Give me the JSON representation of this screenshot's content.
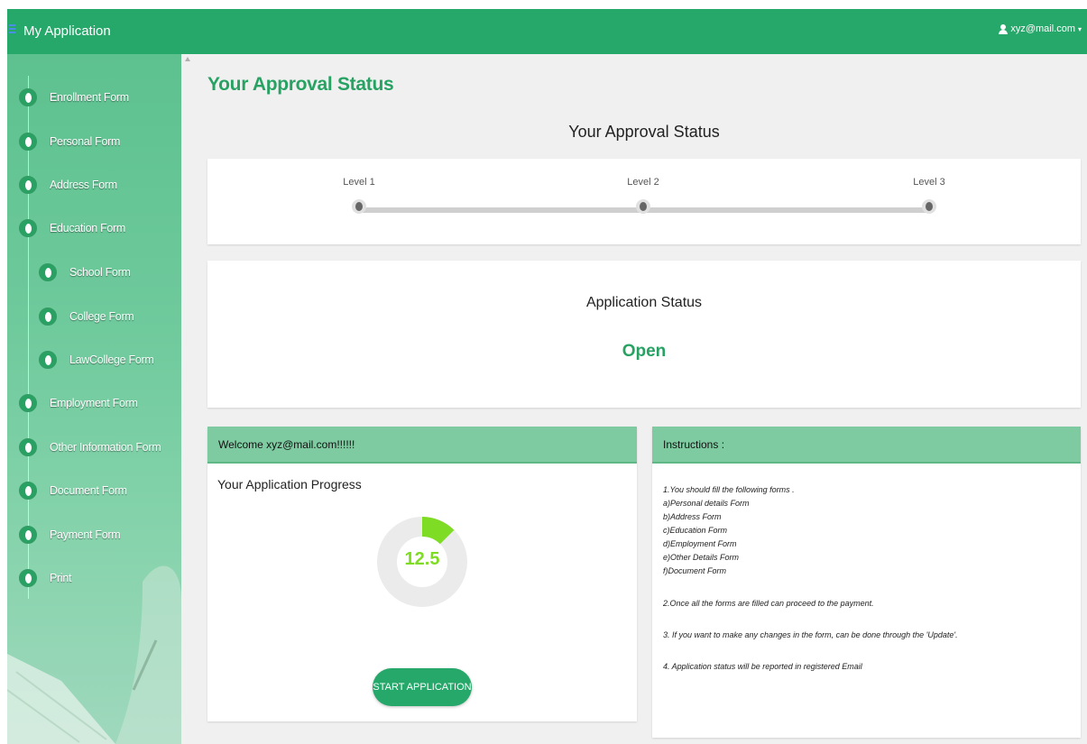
{
  "header": {
    "app_title": "My Application",
    "user_email": "xyz@mail.com",
    "caret": "▾",
    "menu_icon": "hamburger-icon",
    "user_icon": "user-icon"
  },
  "sidebar": {
    "items": [
      {
        "label": "Enrollment Form"
      },
      {
        "label": "Personal Form"
      },
      {
        "label": "Address Form"
      },
      {
        "label": "Education Form"
      },
      {
        "label": "School Form"
      },
      {
        "label": "College Form"
      },
      {
        "label": "LawCollege Form"
      },
      {
        "label": "Employment Form"
      },
      {
        "label": "Other Information Form"
      },
      {
        "label": "Document Form"
      },
      {
        "label": "Payment Form"
      },
      {
        "label": "Print"
      }
    ]
  },
  "main": {
    "page_title": "Your Approval Status",
    "section_title": "Your Approval Status",
    "levels": [
      "Level 1",
      "Level 2",
      "Level 3"
    ],
    "application_status": {
      "title": "Application Status",
      "value": "Open"
    },
    "welcome": {
      "header": "Welcome xyz@mail.com!!!!!!",
      "progress_title": "Your Application Progress",
      "progress_value": "12.5",
      "progress_percent": 12.5,
      "start_button": "START APPLICATION"
    },
    "instructions": {
      "header": "Instructions :",
      "line1": "1.You should fill the following forms .",
      "forms": [
        "a)Personal details Form",
        "b)Address Form",
        "c)Education Form",
        "d)Employment Form",
        "e)Other Details Form",
        "f)Document Form"
      ],
      "line2": "2.Once all the forms are filled can proceed to the payment.",
      "line3": "3. If you want to make any changes in the form, can be done through the 'Update'.",
      "line4": "4. Application status will be reported in registered Email"
    }
  },
  "colors": {
    "brand": "#26a86a",
    "accent_green": "#27a263",
    "progress_fill": "#7fdc24",
    "panel_header": "#7ecba1"
  }
}
